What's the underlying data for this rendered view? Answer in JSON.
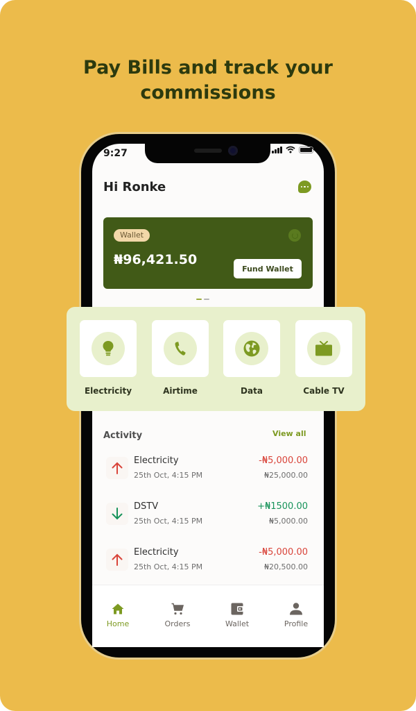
{
  "headline": {
    "line1": "Pay Bills and track your",
    "line2": "commissions"
  },
  "status_bar": {
    "time": "9:27"
  },
  "header": {
    "greeting": "Hi Ronke",
    "chat_icon": "chat-bubble-icon"
  },
  "wallet_card": {
    "pill_label": "Wallet",
    "balance": "₦96,421.50",
    "fund_button_label": "Fund Wallet",
    "refresh_icon": "refresh-icon"
  },
  "carousel": {
    "pages": 2,
    "active_index": 0
  },
  "services": [
    {
      "label": "Electricity",
      "icon": "lightbulb-icon"
    },
    {
      "label": "Airtime",
      "icon": "phone-icon"
    },
    {
      "label": "Data",
      "icon": "globe-icon"
    },
    {
      "label": "Cable TV",
      "icon": "tv-icon"
    }
  ],
  "activity": {
    "title": "Activity",
    "view_all_label": "View all",
    "transactions": [
      {
        "name": "Electricity",
        "date": "25th Oct, 4:15 PM",
        "amount": "-₦5,000.00",
        "balance": "₦25,000.00",
        "direction": "up"
      },
      {
        "name": "DSTV",
        "date": "25th Oct, 4:15 PM",
        "amount": "+₦1500.00",
        "balance": "₦5,000.00",
        "direction": "down"
      },
      {
        "name": "Electricity",
        "date": "25th Oct, 4:15 PM",
        "amount": "-₦5,000.00",
        "balance": "₦20,500.00",
        "direction": "up"
      }
    ]
  },
  "bottom_nav": {
    "active": "Home",
    "items": [
      {
        "label": "Home",
        "icon": "home-icon"
      },
      {
        "label": "Orders",
        "icon": "cart-icon"
      },
      {
        "label": "Wallet",
        "icon": "wallet-icon"
      },
      {
        "label": "Profile",
        "icon": "profile-icon"
      }
    ]
  },
  "colors": {
    "background": "#ecbb4b",
    "headline": "#2c3a0e",
    "brand_green": "#7d9a22",
    "wallet_card": "#415a17",
    "services_panel": "#e8f0cc",
    "debit_red": "#d9443a",
    "credit_green": "#17935a",
    "nav_inactive": "#6b6560"
  }
}
